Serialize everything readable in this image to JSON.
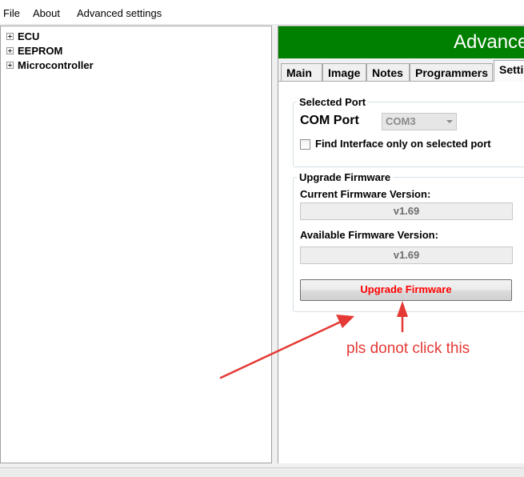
{
  "menubar": {
    "items": [
      "File",
      "About",
      "Advanced settings"
    ]
  },
  "tree": {
    "items": [
      "ECU",
      "EEPROM",
      "Microcontroller"
    ]
  },
  "header": {
    "title": "Advanced",
    "bg_color": "#008000"
  },
  "tabs": [
    {
      "label": "Main",
      "active": false
    },
    {
      "label": "Image",
      "active": false
    },
    {
      "label": "Notes",
      "active": false
    },
    {
      "label": "Programmers",
      "active": false
    },
    {
      "label": "Settings",
      "active": true
    }
  ],
  "settings": {
    "selected_port": {
      "group_title": "Selected Port",
      "com_label": "COM Port",
      "com_value": "COM3",
      "find_interface_label": "Find Interface only on selected port",
      "find_interface_checked": false
    },
    "upgrade_firmware": {
      "group_title": "Upgrade Firmware",
      "current_label": "Current Firmware Version:",
      "current_value": "v1.69",
      "available_label": "Available Firmware Version:",
      "available_value": "v1.69",
      "button_label": "Upgrade Firmware",
      "button_text_color": "#ff0000"
    }
  },
  "annotation": {
    "text": "pls donot click this",
    "color": "#e53935"
  }
}
